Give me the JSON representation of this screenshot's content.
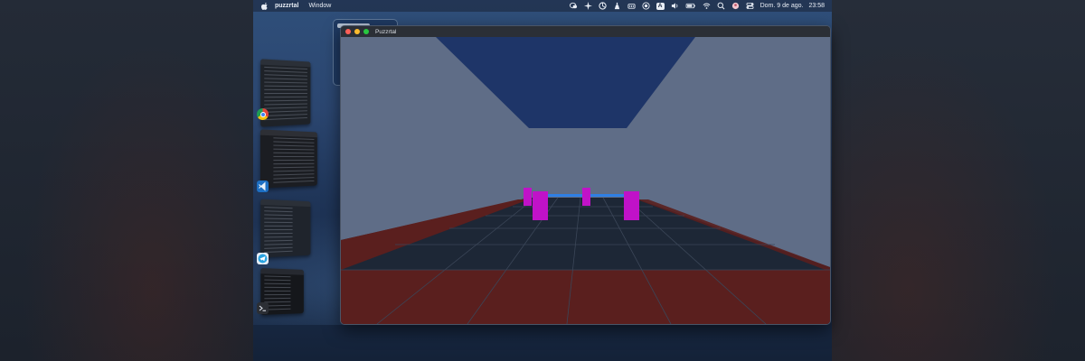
{
  "menubar": {
    "app_name": "puzzrtal",
    "menus": [
      "Window"
    ],
    "status_icons": [
      "wechat-icon",
      "sparkle-icon",
      "circle-icon",
      "weight-icon",
      "drive-icon",
      "record-icon",
      "input-source-icon",
      "volume-icon",
      "battery-icon",
      "wifi-icon",
      "search-icon",
      "user-avatar-icon",
      "control-center-icon"
    ],
    "input_source_label": "A",
    "date": "Dom. 9 de ago.",
    "time": "23:58"
  },
  "window": {
    "title": "Puzzrtal"
  },
  "switcher": {
    "apps": [
      "chrome-icon",
      "vscode-icon",
      "telegram-icon",
      "terminal-icon"
    ]
  },
  "colors": {
    "wall": "#5f6d87",
    "ceiling_gap": "#1e3568",
    "floor_dark": "#1d2736",
    "floor_red": "#5a1f1e",
    "pillar": "#c012c8",
    "portal": "#2f7fe4"
  }
}
